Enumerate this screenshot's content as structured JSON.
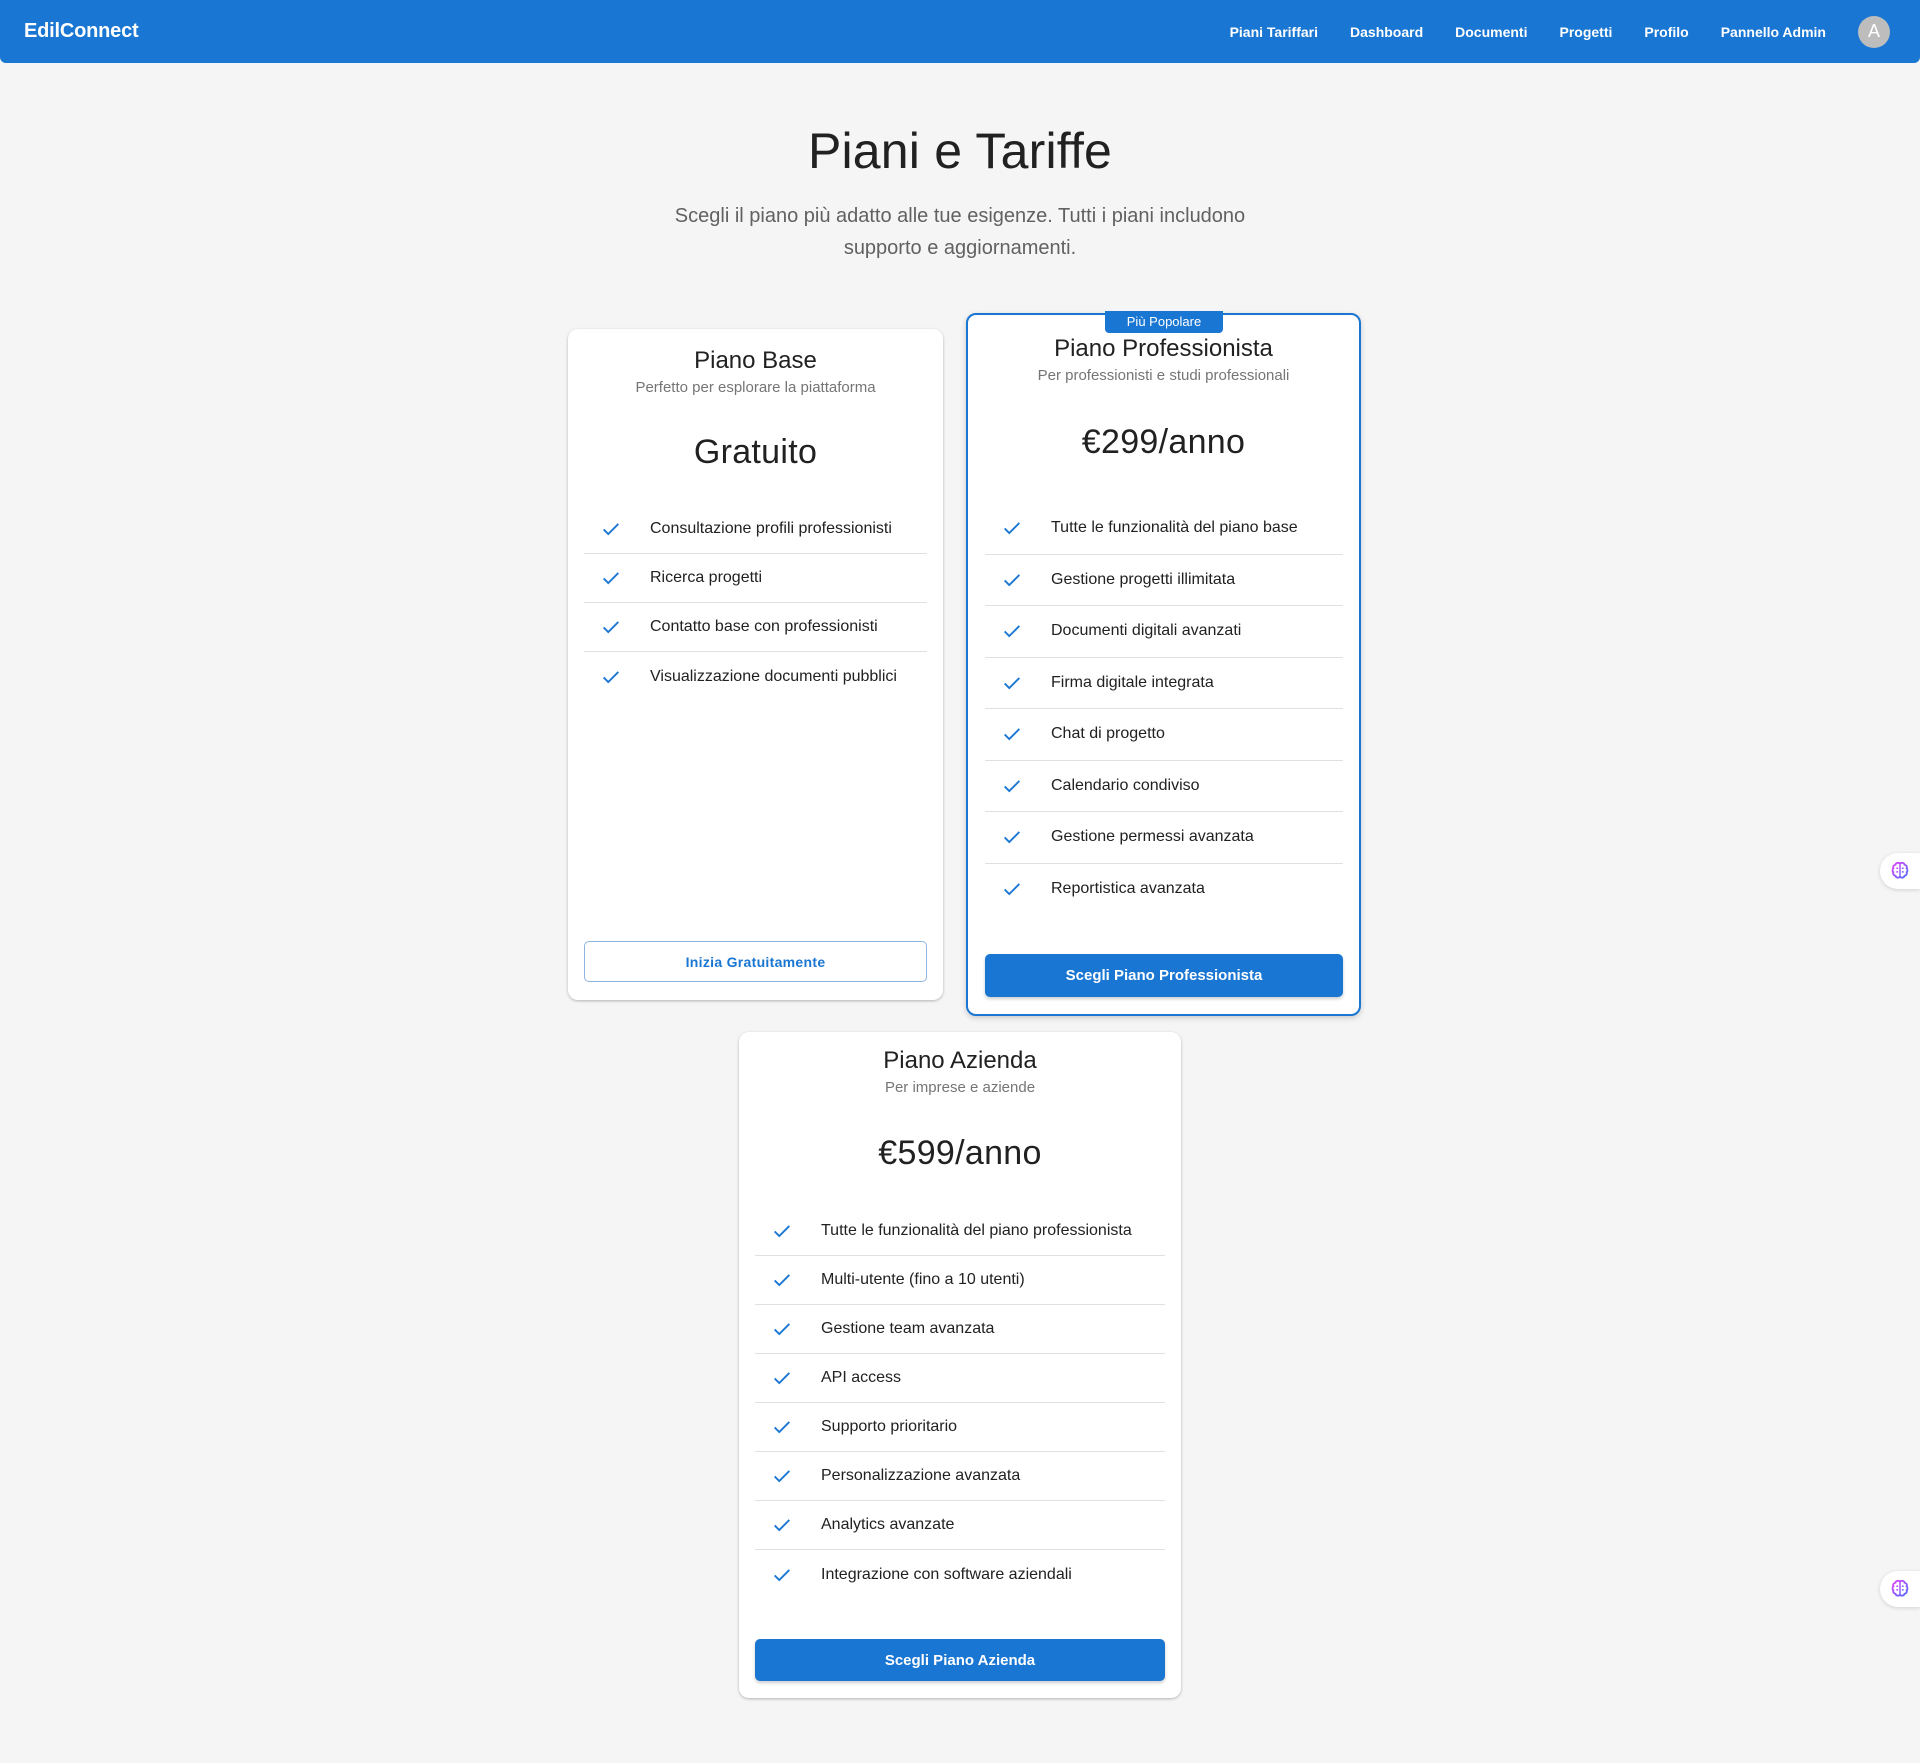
{
  "app": {
    "brand": "EdilConnect",
    "nav": [
      "Piani Tariffari",
      "Dashboard",
      "Documenti",
      "Progetti",
      "Profilo",
      "Pannello Admin"
    ],
    "avatar_initial": "A"
  },
  "header": {
    "title": "Piani e Tariffe",
    "subtitle": "Scegli il piano più adatto alle tue esigenze. Tutti i piani includono supporto e aggiornamenti."
  },
  "plans": {
    "base": {
      "title": "Piano Base",
      "description": "Perfetto per esplorare la piattaforma",
      "price": "Gratuito",
      "features": [
        "Consultazione profili professionisti",
        "Ricerca progetti",
        "Contatto base con professionisti",
        "Visualizzazione documenti pubblici"
      ],
      "button": "Inizia Gratuitamente"
    },
    "pro": {
      "badge": "Più Popolare",
      "title": "Piano Professionista",
      "description": "Per professionisti e studi professionali",
      "price": "€299/anno",
      "features": [
        "Tutte le funzionalità del piano base",
        "Gestione progetti illimitata",
        "Documenti digitali avanzati",
        "Firma digitale integrata",
        "Chat di progetto",
        "Calendario condiviso",
        "Gestione permessi avanzata",
        "Reportistica avanzata"
      ],
      "button": "Scegli Piano Professionista"
    },
    "business": {
      "title": "Piano Azienda",
      "description": "Per imprese e aziende",
      "price": "€599/anno",
      "features": [
        "Tutte le funzionalità del piano professionista",
        "Multi-utente (fino a 10 utenti)",
        "Gestione team avanzata",
        "API access",
        "Supporto prioritario",
        "Personalizzazione avanzata",
        "Analytics avanzate",
        "Integrazione con software aziendali"
      ],
      "button": "Scegli Piano Azienda"
    }
  },
  "colors": {
    "primary": "#1976d2",
    "background": "#f5f5f5"
  },
  "icons": {
    "feature": "check-icon",
    "widget": "brain-icon"
  }
}
